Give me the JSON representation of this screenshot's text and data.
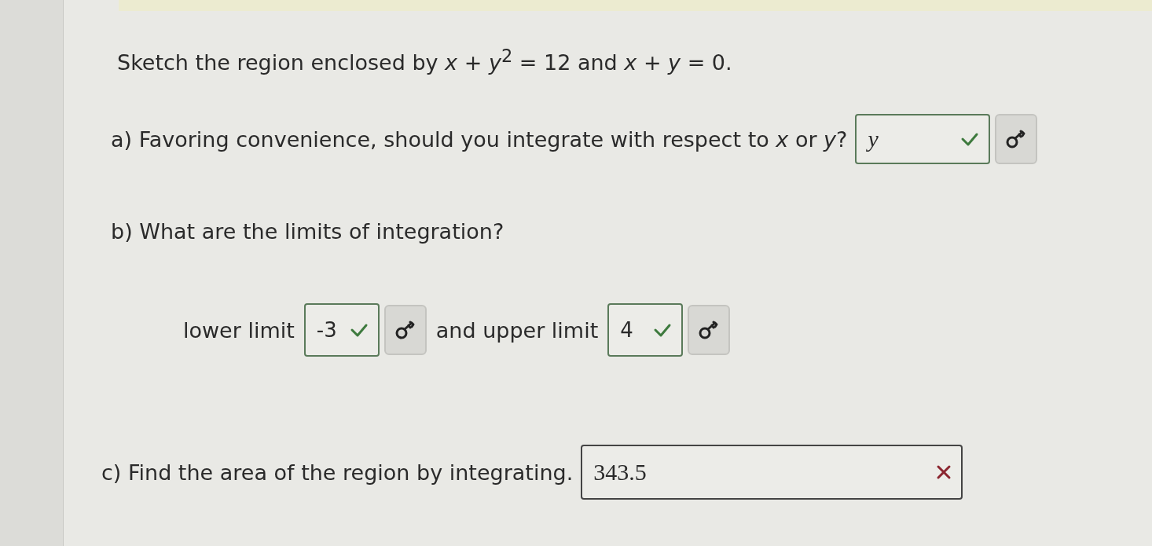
{
  "prompt": "Sketch the region enclosed by *x* + *y*$^{2}$ = 12 and *x* + *y* = 0.",
  "parts": [
    {
      "question": "a) Favoring convenience, should you integrate with respect to *x* or *y*?",
      "inline": [
        {
          "kind": "answer",
          "value": "y",
          "math": true,
          "correct": true,
          "key": true
        }
      ]
    },
    {
      "question": "b) What are the limits of integration?",
      "line": [
        {
          "kind": "text",
          "text": "lower limit"
        },
        {
          "kind": "answer",
          "value": "-3",
          "math": false,
          "correct": true,
          "key": true
        },
        {
          "kind": "text",
          "text": "and upper limit"
        },
        {
          "kind": "answer",
          "value": "4",
          "math": false,
          "correct": true,
          "key": true
        }
      ]
    },
    {
      "question": "c) Find the area of the region by integrating.",
      "inline": [
        {
          "kind": "answer",
          "value": "343.5",
          "math": true,
          "correct": false,
          "key": false
        }
      ]
    }
  ]
}
